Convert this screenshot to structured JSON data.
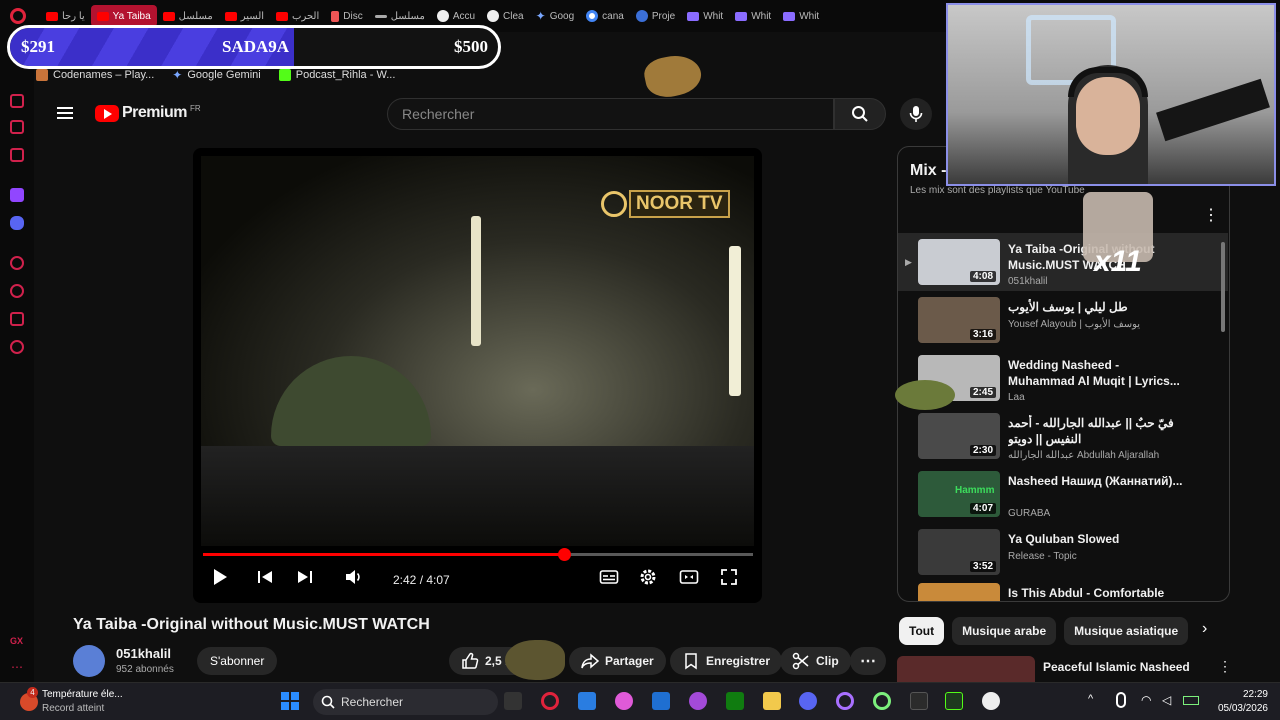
{
  "browser": {
    "tabs": [
      {
        "label": "يا رحا",
        "icon": "youtube-icon",
        "active": false
      },
      {
        "label": "Ya Taiba",
        "icon": "youtube-icon",
        "active": true
      },
      {
        "label": "مسلسل",
        "icon": "youtube-icon",
        "active": false
      },
      {
        "label": "السير",
        "icon": "youtube-icon",
        "active": false
      },
      {
        "label": "الحرب",
        "icon": "youtube-icon",
        "active": false
      },
      {
        "label": "Disc",
        "icon": "doc-icon",
        "active": false
      },
      {
        "label": "مسلسل",
        "icon": "wave-icon",
        "active": false
      },
      {
        "label": "Accu",
        "icon": "openai-icon",
        "active": false
      },
      {
        "label": "Clea",
        "icon": "openai-icon",
        "active": false
      },
      {
        "label": "Goog",
        "icon": "gemini-icon",
        "active": false
      },
      {
        "label": "cana",
        "icon": "google-icon",
        "active": false
      },
      {
        "label": "Proje",
        "icon": "copilot-icon",
        "active": false
      },
      {
        "label": "Whit",
        "icon": "shield-icon",
        "active": false
      },
      {
        "label": "Whit",
        "icon": "shield-icon",
        "active": false
      },
      {
        "label": "Whit",
        "icon": "shield-icon",
        "active": false
      }
    ],
    "bookmarks": [
      {
        "label": "Codenames – Play...",
        "icon": "codenames-icon"
      },
      {
        "label": "Google Gemini",
        "icon": "gemini-icon"
      },
      {
        "label": "Podcast_Rihla - W...",
        "icon": "kick-icon"
      }
    ]
  },
  "goal": {
    "current": "$291",
    "name": "SADA9A",
    "target": "$500",
    "progress": 0.582,
    "fill_color": "#3b2fc9"
  },
  "header": {
    "logo": "Premium",
    "logo_sup": "FR",
    "search_placeholder": "Rechercher"
  },
  "player": {
    "channel_watermark": "NOOR TV",
    "time_current": "2:42",
    "time_total": "4:07",
    "progress": 0.656
  },
  "video": {
    "title": "Ya Taiba -Original without Music.MUST WATCH",
    "channel": "051khalil",
    "subscribers": "952 abonnés",
    "subscribe_label": "S'abonner",
    "likes": "2,5 k",
    "share_label": "Partager",
    "save_label": "Enregistrer",
    "clip_label": "Clip"
  },
  "mix": {
    "title": "Mix -",
    "subtitle": "Les mix sont des playlists que YouTube",
    "items": [
      {
        "title": "Ya Taiba -Original without Music.MUST WATCH",
        "channel": "051khalil",
        "duration": "4:08",
        "current": true,
        "thumb": "#c9ccd2"
      },
      {
        "title": "طل ليلي | يوسف الأيوب",
        "channel": "Yousef Alayoub | يوسف الأيوب",
        "duration": "3:16",
        "current": false,
        "thumb": "#6b5a4a"
      },
      {
        "title": "Wedding Nasheed - Muhammad Al Muqit | Lyrics...",
        "channel": "Laa",
        "duration": "2:45",
        "current": false,
        "thumb": "#b8b8b8"
      },
      {
        "title": "فيّ حبٌ || عبدالله الجارالله - أحمد النفيس || دويتو",
        "channel": "عبدالله الجارالله Abdullah Aljarallah",
        "duration": "2:30",
        "current": false,
        "thumb": "#4a4a4a"
      },
      {
        "title": "Nasheed Нашид (Жаннатий)...",
        "channel": "GURABA",
        "duration": "4:07",
        "current": false,
        "thumb": "#2d5a3a"
      },
      {
        "title": "Ya Quluban Slowed",
        "channel": "Release - Topic",
        "duration": "3:52",
        "current": false,
        "thumb": "#3a3a3a"
      },
      {
        "title": "Is This Abdul - Comfortable Path",
        "channel": "",
        "duration": "",
        "current": false,
        "thumb": "#c98a3a"
      }
    ]
  },
  "chips": [
    "Tout",
    "Musique arabe",
    "Musique asiatique"
  ],
  "next_video": {
    "title": "Peaceful Islamic Nasheed"
  },
  "overlay": {
    "combo": "x11",
    "chat_user": "Hammm"
  },
  "taskbar": {
    "weather_title": "Température éle...",
    "weather_sub": "Record atteint",
    "weather_badge": "4",
    "search_placeholder": "Rechercher",
    "time": "22:29",
    "date": "05/03/2026"
  }
}
